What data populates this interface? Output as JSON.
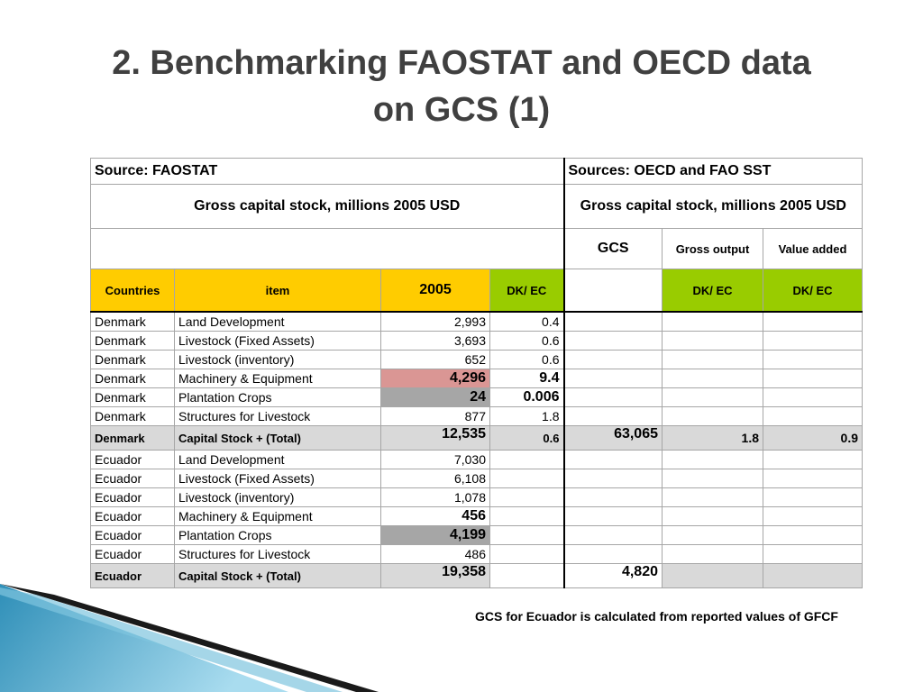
{
  "title_line1": "2. Benchmarking FAOSTAT and OECD data",
  "title_line2": "on GCS (1)",
  "table": {
    "source_left": "Source: FAOSTAT",
    "source_right": "Sources: OECD and FAO SST",
    "gcs_left": "Gross capital stock, millions 2005 USD",
    "gcs_right": "Gross capital stock, millions 2005 USD",
    "sub_gcs": "GCS",
    "sub_gross_output": "Gross output",
    "sub_value_added": "Value added",
    "col_countries": "Countries",
    "col_item": "item",
    "col_2005": "2005",
    "col_dkec1": "DK/ EC",
    "col_dkec2": "DK/ EC",
    "col_dkec3": "DK/ EC",
    "rows": [
      {
        "country": "Denmark",
        "item": "Land Development",
        "v2005": "2,993",
        "ratio": "0.4"
      },
      {
        "country": "Denmark",
        "item": "Livestock (Fixed Assets)",
        "v2005": "3,693",
        "ratio": "0.6"
      },
      {
        "country": "Denmark",
        "item": "Livestock (inventory)",
        "v2005": "652",
        "ratio": "0.6"
      },
      {
        "country": "Denmark",
        "item": "Machinery & Equipment",
        "v2005": "4,296",
        "ratio": "9.4"
      },
      {
        "country": "Denmark",
        "item": "Plantation Crops",
        "v2005": "24",
        "ratio": "0.006"
      },
      {
        "country": "Denmark",
        "item": "Structures for Livestock",
        "v2005": "877",
        "ratio": "1.8"
      },
      {
        "country": "Denmark",
        "item": "Capital Stock + (Total)",
        "v2005": "12,535",
        "ratio": "0.6",
        "gcs": "63,065",
        "go": "1.8",
        "va": "0.9"
      },
      {
        "country": "Ecuador",
        "item": "Land Development",
        "v2005": "7,030"
      },
      {
        "country": "Ecuador",
        "item": "Livestock (Fixed Assets)",
        "v2005": "6,108"
      },
      {
        "country": "Ecuador",
        "item": "Livestock (inventory)",
        "v2005": "1,078"
      },
      {
        "country": "Ecuador",
        "item": "Machinery & Equipment",
        "v2005": "456"
      },
      {
        "country": "Ecuador",
        "item": "Plantation Crops",
        "v2005": "4,199"
      },
      {
        "country": "Ecuador",
        "item": "Structures for Livestock",
        "v2005": "486"
      },
      {
        "country": "Ecuador",
        "item": "Capital Stock + (Total)",
        "v2005": "19,358",
        "gcs": "4,820"
      }
    ]
  },
  "footnote": "GCS for Ecuador is calculated from reported values of GFCF"
}
